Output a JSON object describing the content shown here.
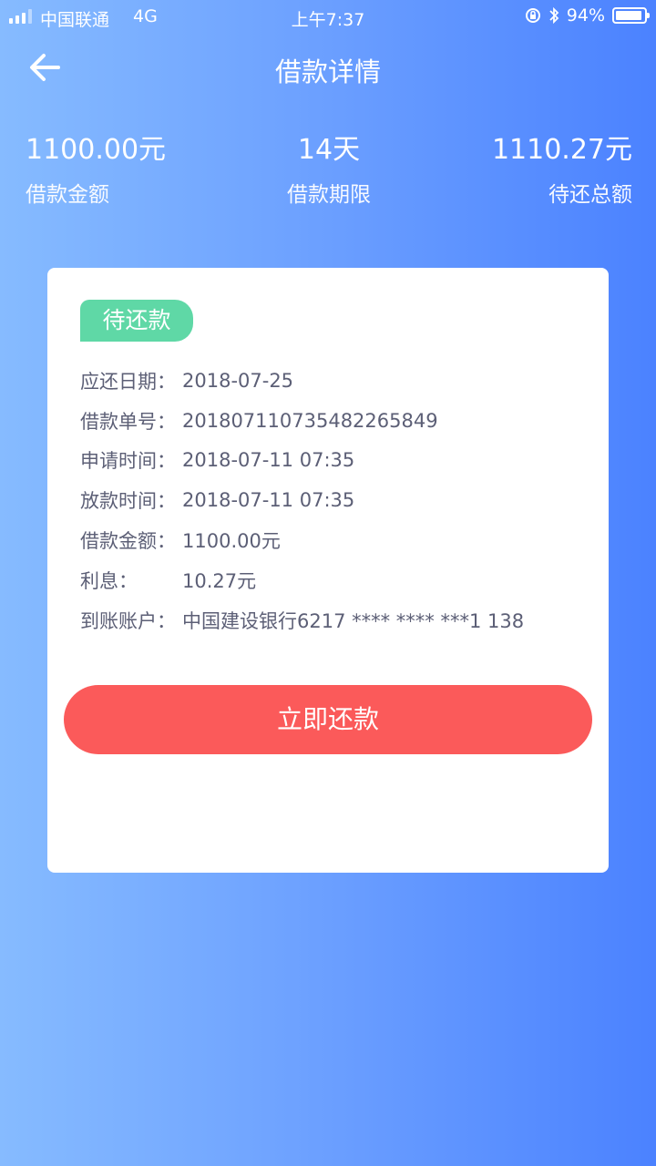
{
  "status_bar": {
    "carrier": "中国联通",
    "network": "4G",
    "time": "上午7:37",
    "battery": "94%",
    "battery_level": 0.94
  },
  "nav": {
    "title": "借款详情",
    "back_icon": "arrow-left-icon"
  },
  "summary": {
    "amount": {
      "value": "1100.00元",
      "label": "借款金额"
    },
    "term": {
      "value": "14天",
      "label": "借款期限"
    },
    "total": {
      "value": "1110.27元",
      "label": "待还总额"
    }
  },
  "card": {
    "status_badge": "待还款",
    "details": [
      {
        "label": "应还日期：",
        "value": "2018-07-25"
      },
      {
        "label": "借款单号：",
        "value": "20180711073548226584​9"
      },
      {
        "label": "申请时间：",
        "value": "2018-07-11 07:35"
      },
      {
        "label": "放款时间：",
        "value": "2018-07-11 07:35"
      },
      {
        "label": "借款金额：",
        "value": "1100.00元"
      },
      {
        "label": "利息：",
        "value": "10.27元"
      },
      {
        "label": "到账账户：",
        "value": "中国建设银行6217 **** **** ***1 138"
      }
    ],
    "pay_button": "立即还款"
  },
  "colors": {
    "badge": "#5fd8a6",
    "pay_button": "#fb5a5a",
    "gradient_start": "#86bbff",
    "gradient_end": "#4b82ff"
  }
}
